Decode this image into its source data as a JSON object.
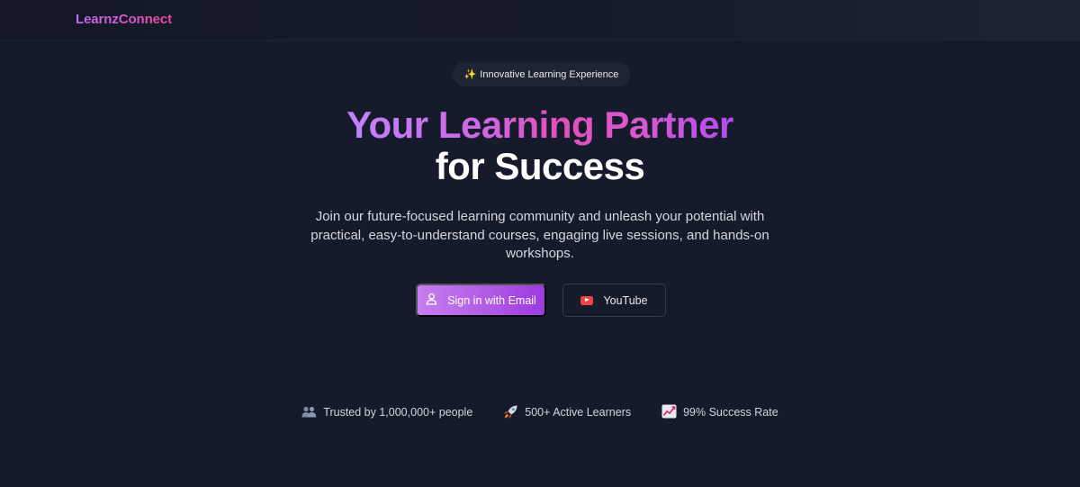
{
  "brand": "LearnzConnect",
  "badge": {
    "icon": "sparkles-icon",
    "text": "Innovative Learning Experience"
  },
  "hero": {
    "title_gradient": "Your Learning Partner",
    "title_plain": "for Success",
    "subtitle": "Join our future-focused learning community and unleash your potential with practical, easy-to-understand courses, engaging live sessions, and hands-on workshops."
  },
  "buttons": {
    "email": {
      "label": "Sign in with Email",
      "icon": "user-icon"
    },
    "youtube": {
      "label": "YouTube",
      "icon": "youtube-icon"
    }
  },
  "stats": [
    {
      "icon": "people-icon",
      "text": "Trusted by 1,000,000+ people"
    },
    {
      "icon": "rocket-icon",
      "text": "500+ Active Learners"
    },
    {
      "icon": "chart-increasing-icon",
      "text": "99% Success Rate"
    }
  ],
  "colors": {
    "background": "#161b2c",
    "accent_purple": "#c084fc",
    "accent_pink": "#ec4899",
    "youtube_red": "#ef4444"
  }
}
